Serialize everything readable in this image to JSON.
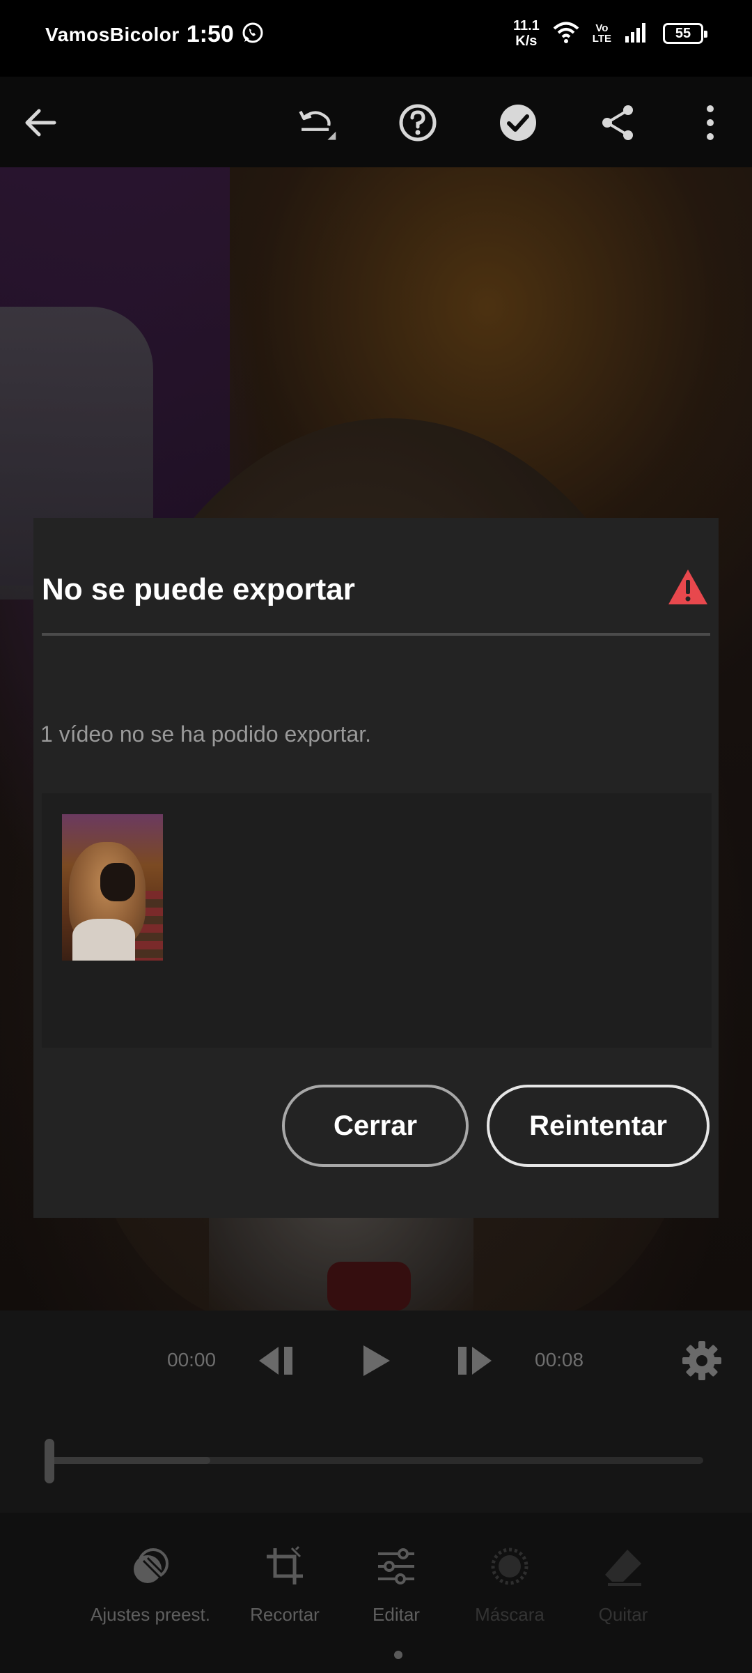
{
  "status_bar": {
    "carrier": "VamosBicolor",
    "time": "1:50",
    "speed_value": "11.1",
    "speed_unit": "K/s",
    "volte_top": "Vo",
    "volte_bottom": "LTE",
    "battery": "55"
  },
  "toolbar": {
    "icons": [
      "back-arrow-icon",
      "undo-icon",
      "help-icon",
      "checkmark-icon",
      "share-icon",
      "more-vertical-icon"
    ]
  },
  "dialog": {
    "title": "No se puede exportar",
    "message": "1 vídeo no se ha podido exportar.",
    "close_label": "Cerrar",
    "retry_label": "Reintentar",
    "warning_color": "#e8484d"
  },
  "player": {
    "current_time": "00:00",
    "duration": "00:08",
    "progress": 0.25
  },
  "tools": {
    "items": [
      {
        "label": "Ajustes preest.",
        "icon": "presets-icon",
        "enabled": true
      },
      {
        "label": "Recortar",
        "icon": "crop-icon",
        "enabled": true
      },
      {
        "label": "Editar",
        "icon": "sliders-icon",
        "enabled": true
      },
      {
        "label": "Máscara",
        "icon": "mask-icon",
        "enabled": false
      },
      {
        "label": "Quitar",
        "icon": "eraser-icon",
        "enabled": false
      }
    ]
  }
}
